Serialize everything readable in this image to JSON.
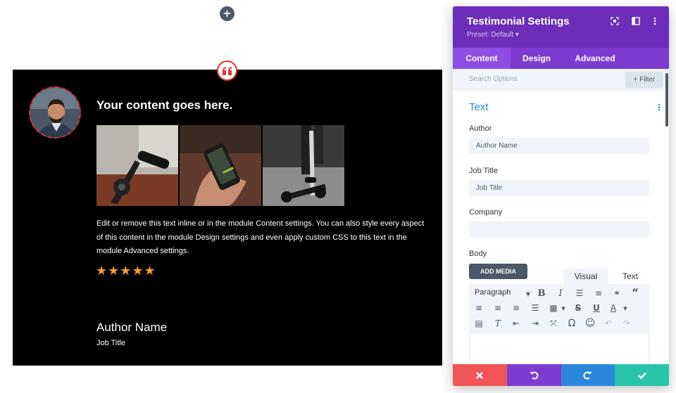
{
  "canvas": {
    "add_row_label": "+"
  },
  "testimonial": {
    "heading": "Your content goes here.",
    "body": "Edit or remove this text inline or in the module Content settings. You can also style every aspect of this content in the module Design settings and even apply custom CSS to this text in the module Advanced settings.",
    "rating": 5,
    "stars": "★★★★★",
    "author": "Author Name",
    "job_title": "Job Title",
    "photos": [
      "scooter-handlebar-photo",
      "phone-in-hand-photo",
      "person-riding-scooter-photo"
    ]
  },
  "panel": {
    "title": "Testimonial Settings",
    "preset": "Preset: Default ▾",
    "tabs": [
      {
        "label": "Content",
        "active": true
      },
      {
        "label": "Design",
        "active": false
      },
      {
        "label": "Advanced",
        "active": false
      }
    ],
    "search_placeholder": "Search Options",
    "filter_label": "+ Filter",
    "section_title": "Text",
    "fields": {
      "author": {
        "label": "Author",
        "value": "Author Name"
      },
      "job_title": {
        "label": "Job Title",
        "value": "Job Title"
      },
      "company": {
        "label": "Company",
        "value": ""
      },
      "body": {
        "label": "Body"
      }
    },
    "add_media_label": "ADD MEDIA",
    "editor_tabs": {
      "visual": "Visual",
      "text": "Text"
    },
    "paragraph_select": "Paragraph"
  },
  "colors": {
    "module_bg": "#000000",
    "panel_header": "#6c2eb9",
    "panel_tabs": "#7d3bd0",
    "accent_blue": "#2b87da",
    "star": "#f39c2f",
    "discard": "#ef5555",
    "undo": "#7e3bd0",
    "redo": "#2b87da",
    "save": "#29c4a9"
  }
}
